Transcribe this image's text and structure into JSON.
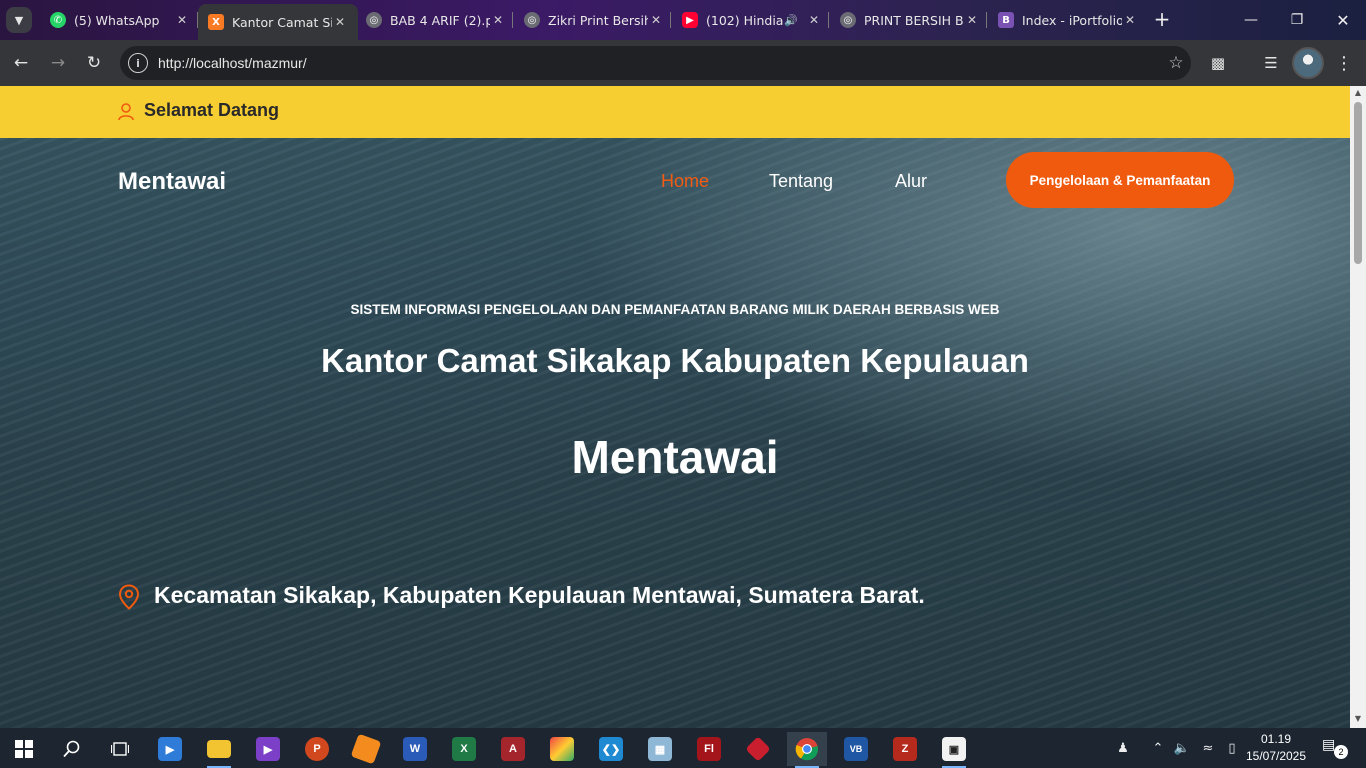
{
  "browser": {
    "tabs": [
      {
        "title": "(5) WhatsApp",
        "icon": "whatsapp-icon",
        "color": "#25d366"
      },
      {
        "title": "Kantor Camat Sik",
        "icon": "xampp-icon",
        "color": "#fb7a24",
        "active": true
      },
      {
        "title": "BAB 4 ARIF (2).p",
        "icon": "globe-icon",
        "color": "#8a8a8a"
      },
      {
        "title": "Zikri Print Bersih",
        "icon": "globe-icon",
        "color": "#8a8a8a"
      },
      {
        "title": "(102) Hindia",
        "icon": "youtube-icon",
        "color": "#ff0033",
        "audio": true
      },
      {
        "title": "PRINT BERSIH BI",
        "icon": "globe-icon",
        "color": "#8a8a8a"
      },
      {
        "title": "Index - iPortfolio",
        "icon": "bootstrap-icon",
        "color": "#7952b3"
      }
    ],
    "url": "http://localhost/mazmur/"
  },
  "page": {
    "welcome": "Selamat Datang",
    "brand": "Mentawai",
    "nav": {
      "home": "Home",
      "about": "Tentang",
      "flow": "Alur",
      "cta": "Pengelolaan & Pemanfaatan"
    },
    "hero": {
      "subtitle": "SISTEM INFORMASI PENGELOLAAN DAN PEMANFAATAN BARANG MILIK DAERAH BERBASIS WEB",
      "title_line1": "Kantor Camat Sikakap Kabupaten Kepulauan",
      "title_line2": "Mentawai",
      "location": "Kecamatan Sikakap, Kabupaten Kepulauan Mentawai, Sumatera Barat."
    },
    "colors": {
      "topbar": "#f6ce31",
      "accent": "#f05a0e"
    }
  },
  "taskbar": {
    "apps": [
      "start-icon",
      "search-icon",
      "task-view-icon",
      "media-player-icon",
      "file-explorer-icon",
      "visual-studio-icon",
      "powerpoint-icon",
      "sublime-icon",
      "word-icon",
      "excel-icon",
      "access-icon",
      "tool-icon",
      "vscode-icon",
      "virtualbox-icon",
      "flash-icon",
      "git-icon",
      "chrome-icon",
      "vb-icon",
      "filezilla-icon",
      "app-icon"
    ],
    "app_labels": {
      "flash": "Fl",
      "word": "W",
      "excel": "X",
      "access": "A",
      "powerpoint": "P",
      "vb": "VB",
      "filezilla": "Z"
    },
    "time": "01.19",
    "date": "15/07/2025",
    "notification_count": "2"
  }
}
